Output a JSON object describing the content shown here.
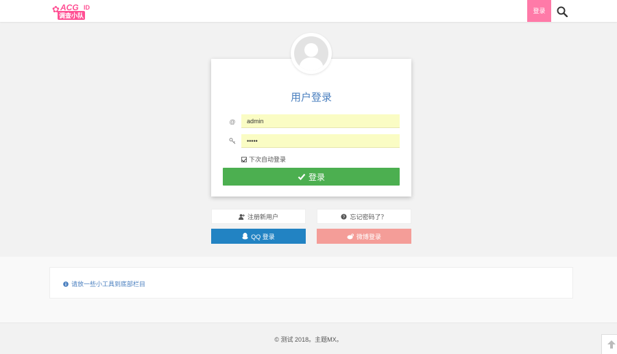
{
  "header": {
    "logo_top": "ACG",
    "logo_sub": "调查小队",
    "logo_tail": "ID",
    "login_label": "登录"
  },
  "login_card": {
    "title": "用户登录",
    "username_value": "admin",
    "password_value": "•••••",
    "username_icon": "@",
    "remember_label": "下次自动登录",
    "submit_label": "登录"
  },
  "links": {
    "register_label": "注册新用户",
    "forgot_label": "忘记密码了？",
    "qq_label": "QQ 登录",
    "weibo_label": "微博登录"
  },
  "notice": {
    "text": "请放一些小工具到底部栏目"
  },
  "footer": {
    "text": "© 测试 2018。主题MX。"
  },
  "colors": {
    "accent_pink": "#ff7aa8",
    "title_blue": "#4a7fbf",
    "submit_green": "#4caf50",
    "qq_blue": "#2283c3",
    "weibo_pink": "#f49d98"
  }
}
